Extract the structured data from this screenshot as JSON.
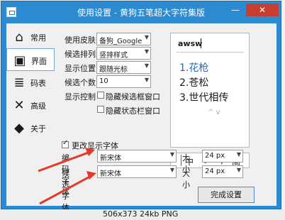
{
  "window": {
    "title": "使用设置 - 黄狗五笔超大字符集版"
  },
  "nav": [
    "常用",
    "界面",
    "码表",
    "高级",
    "关于"
  ],
  "form": {
    "skin": {
      "label": "使用皮肤",
      "value": "备狗_Google在"
    },
    "arrangement": {
      "label": "候选排列",
      "value": "竖排样式"
    },
    "position": {
      "label": "显示位置",
      "value": "跟随光标"
    },
    "count": {
      "label": "候选个数",
      "value": "10"
    },
    "control": {
      "label": "显示控制"
    },
    "hide_candidate": "隐藏候选框窗口",
    "hide_status": "隐藏状态栏窗口"
  },
  "preview": {
    "code": "awsw",
    "candidates": [
      "1.花枪",
      "2.苍松",
      "3.世代相传"
    ],
    "arrows": "^  v"
  },
  "toolbar": {
    "items": [
      "中",
      "☽",
      "°,",
      "简"
    ]
  },
  "fonts": {
    "change_label": "更改显示字体",
    "code_label": "编码字体",
    "cand_label": "候选字体",
    "code_font": "新宋体",
    "cand_font": "新宋体",
    "size_label": "大小",
    "code_size": "24 px",
    "cand_size": "24 px"
  },
  "done_button": "完成设置",
  "caption": "506x373  24kb  PNG"
}
